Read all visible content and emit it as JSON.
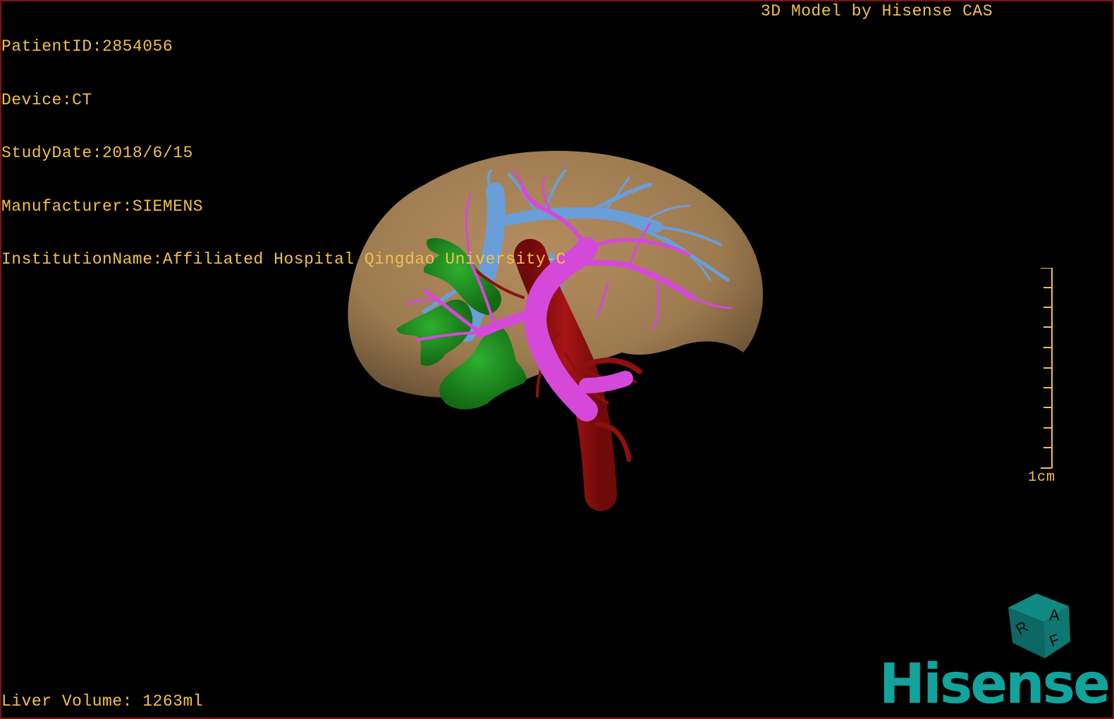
{
  "dicom": {
    "patient_id": "PatientID:2854056",
    "device": "Device:CT",
    "study_date": "StudyDate:2018/6/15",
    "manufacturer": "Manufacturer:SIEMENS",
    "institution": "InstitutionName:Affiliated Hospital Qingdao University-C"
  },
  "header": {
    "model_credit": "3D Model by Hisense CAS"
  },
  "footer": {
    "liver_volume": "Liver Volume: 1263ml",
    "brand": "Hisense"
  },
  "scale": {
    "label": "1cm"
  },
  "orientation_cube": {
    "labels": [
      "A",
      "F",
      "R"
    ]
  },
  "colors": {
    "overlay_text": "#f2c14a",
    "liver": "#a88458",
    "portal_vein": "#d449d8",
    "hepatic_vein": "#6a9ed8",
    "artery": "#9a1010",
    "tumor": "#1d8a1d",
    "brand": "#11a39c",
    "cube": "#0f6f6b"
  }
}
